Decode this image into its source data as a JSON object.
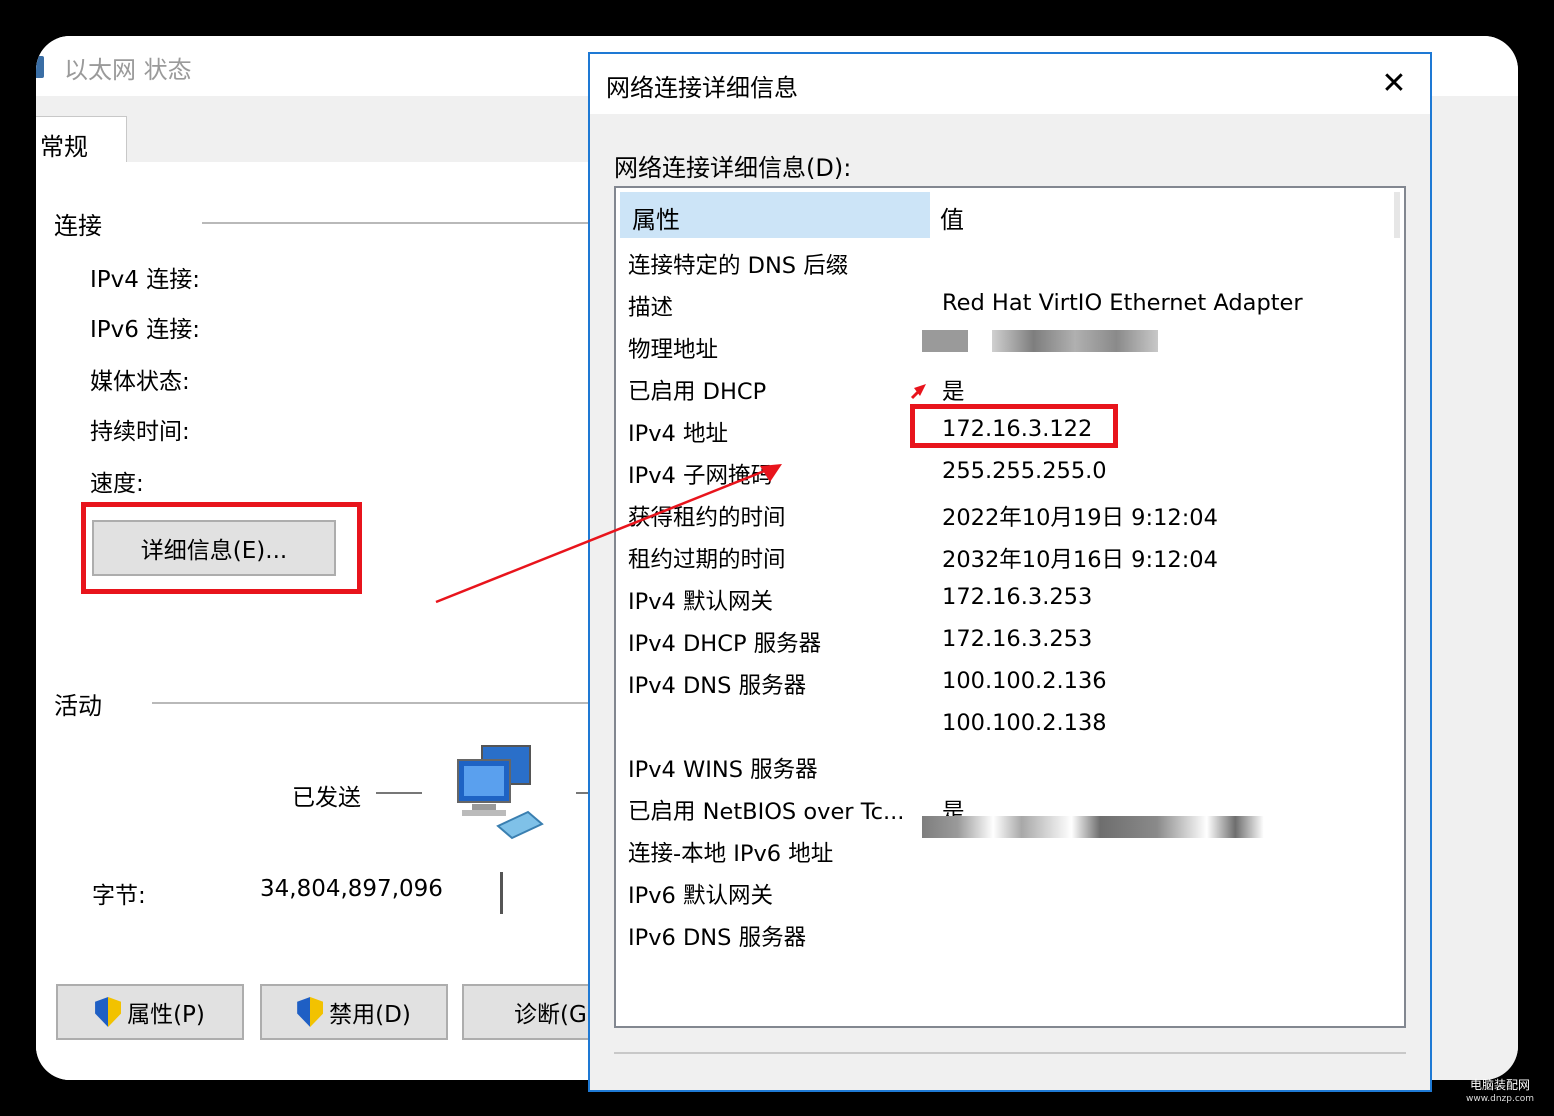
{
  "bg_window": {
    "title": "以太网 状态",
    "tab_general": "常规",
    "connection_group": "连接",
    "fields": [
      "IPv4 连接:",
      "IPv6 连接:",
      "媒体状态:",
      "持续时间:",
      "速度:"
    ],
    "details_button": "详细信息(E)...",
    "activity_group": "活动",
    "sent_label": "已发送",
    "bytes_label": "字节:",
    "bytes_sent": "34,804,897,096",
    "buttons": {
      "properties": "属性(P)",
      "disable": "禁用(D)",
      "diagnose": "诊断(G"
    }
  },
  "dialog": {
    "title": "网络连接详细信息",
    "close": "✕",
    "list_label": "网络连接详细信息(D):",
    "header_property": "属性",
    "header_value": "值",
    "rows": [
      {
        "p": "连接特定的 DNS 后缀",
        "v": ""
      },
      {
        "p": "描述",
        "v": "Red Hat VirtIO Ethernet Adapter"
      },
      {
        "p": "物理地址",
        "v": ""
      },
      {
        "p": "已启用 DHCP",
        "v": "是"
      },
      {
        "p": "IPv4 地址",
        "v": "172.16.3.122"
      },
      {
        "p": "IPv4 子网掩码",
        "v": "255.255.255.0"
      },
      {
        "p": "获得租约的时间",
        "v": "2022年10月19日 9:12:04"
      },
      {
        "p": "租约过期的时间",
        "v": "2032年10月16日 9:12:04"
      },
      {
        "p": "IPv4 默认网关",
        "v": "172.16.3.253"
      },
      {
        "p": "IPv4 DHCP 服务器",
        "v": "172.16.3.253"
      },
      {
        "p": "IPv4 DNS 服务器",
        "v": "100.100.2.136"
      },
      {
        "p": "",
        "v": "100.100.2.138"
      },
      {
        "p": "IPv4 WINS 服务器",
        "v": ""
      },
      {
        "p": "已启用 NetBIOS over Tc...",
        "v": "是"
      },
      {
        "p": "连接-本地 IPv6 地址",
        "v": ""
      },
      {
        "p": "IPv6 默认网关",
        "v": ""
      },
      {
        "p": "IPv6 DNS 服务器",
        "v": ""
      }
    ]
  },
  "watermark": {
    "line1": "电脑装配网",
    "line2": "www.dnzp.com"
  },
  "colors": {
    "highlight": "#e8141c",
    "dialog_border": "#1e79d4",
    "selected_header": "#cce4f7"
  }
}
